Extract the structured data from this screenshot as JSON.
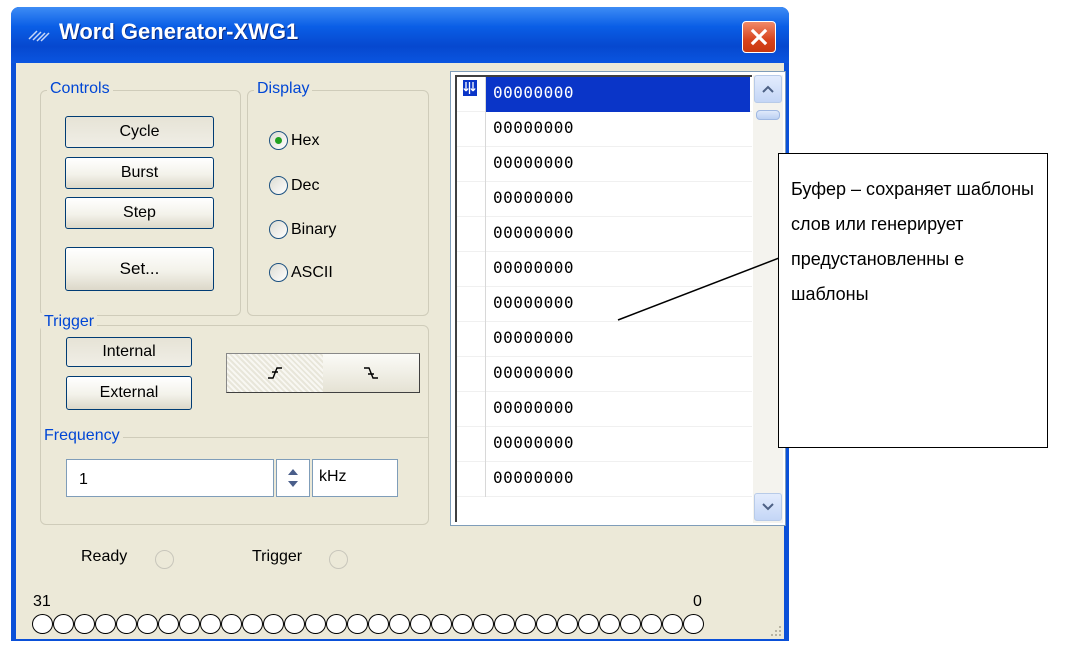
{
  "window": {
    "title": "Word Generator-XWG1"
  },
  "controls": {
    "label": "Controls",
    "cycle": "Cycle",
    "burst": "Burst",
    "step": "Step",
    "set": "Set..."
  },
  "display": {
    "label": "Display",
    "options": [
      "Hex",
      "Dec",
      "Binary",
      "ASCII"
    ],
    "selected": "Hex"
  },
  "trigger": {
    "label": "Trigger",
    "internal": "Internal",
    "external": "External"
  },
  "frequency": {
    "label": "Frequency",
    "value": "1",
    "unit": "kHz"
  },
  "buffer": {
    "rows": [
      "00000000",
      "00000000",
      "00000000",
      "00000000",
      "00000000",
      "00000000",
      "00000000",
      "00000000",
      "00000000",
      "00000000",
      "00000000",
      "00000000"
    ]
  },
  "status": {
    "ready": "Ready",
    "trigger": "Trigger"
  },
  "bits": {
    "high": "31",
    "low": "0"
  },
  "callout": {
    "text": "Буфер – сохраняет шаблоны слов или генерирует предустановленны е шаблоны"
  },
  "colors": {
    "title_bar": "#0a50d8",
    "selection": "#0a35c8",
    "group_label": "#0046d5",
    "close": "#d8431c"
  }
}
